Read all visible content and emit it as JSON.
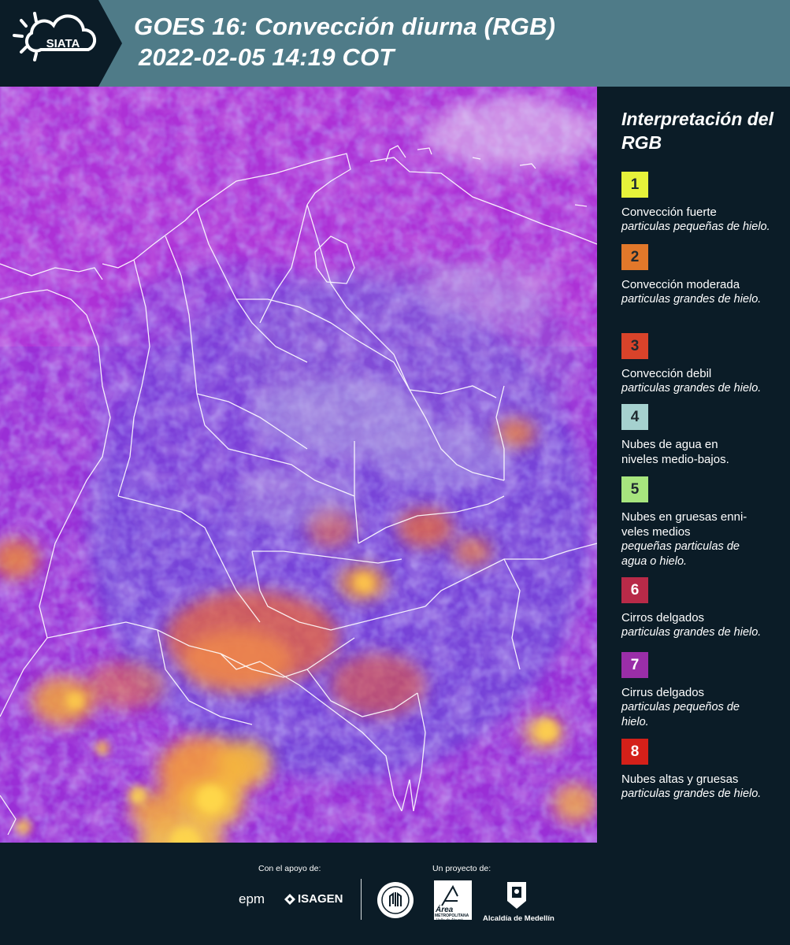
{
  "header": {
    "logo_text": "SIATA",
    "title_line1": "GOES 16: Convección diurna (RGB)",
    "title_line2": "2022-02-05 14:19 COT",
    "background_color": "#4f7b88"
  },
  "legend": {
    "title": "Interpretación del RGB",
    "items": [
      {
        "number": "1",
        "color": "#e6f23a",
        "label": "Convección fuerte",
        "sub": "particulas pequeñas de hielo."
      },
      {
        "number": "2",
        "color": "#e2782a",
        "label": "Convección moderada",
        "sub": "particulas grandes de hielo."
      },
      {
        "number": "3",
        "color": "#d9432a",
        "label": "Convección debil",
        "sub": "particulas grandes de hielo."
      },
      {
        "number": "4",
        "color": "#a5d1cf",
        "label": "Nubes de agua en niveles medio-bajos.",
        "sub": ""
      },
      {
        "number": "5",
        "color": "#a7e57e",
        "label": "Nubes en gruesas enni-veles medios",
        "sub": "pequeñas particulas de agua o hielo."
      },
      {
        "number": "6",
        "color": "#b82a48",
        "label": "Cirros delgados",
        "sub": "particulas grandes de hielo."
      },
      {
        "number": "7",
        "color": "#9a2ea8",
        "label": "Cirrus delgados",
        "sub": "particulas pequeños de hielo."
      },
      {
        "number": "8",
        "color": "#d42019",
        "label": "Nubes altas y gruesas",
        "sub": "particulas grandes de hielo."
      }
    ]
  },
  "footer": {
    "support_label": "Con el apoyo de:",
    "project_label": "Un proyecto de:",
    "sponsor1": "epm",
    "sponsor2": "ISAGEN",
    "area_text": "Área",
    "area_sub": "METROPOLITANA",
    "area_sub2": "Valle de Aburrá",
    "alcaldia": "Alcaldía de Medellín"
  }
}
